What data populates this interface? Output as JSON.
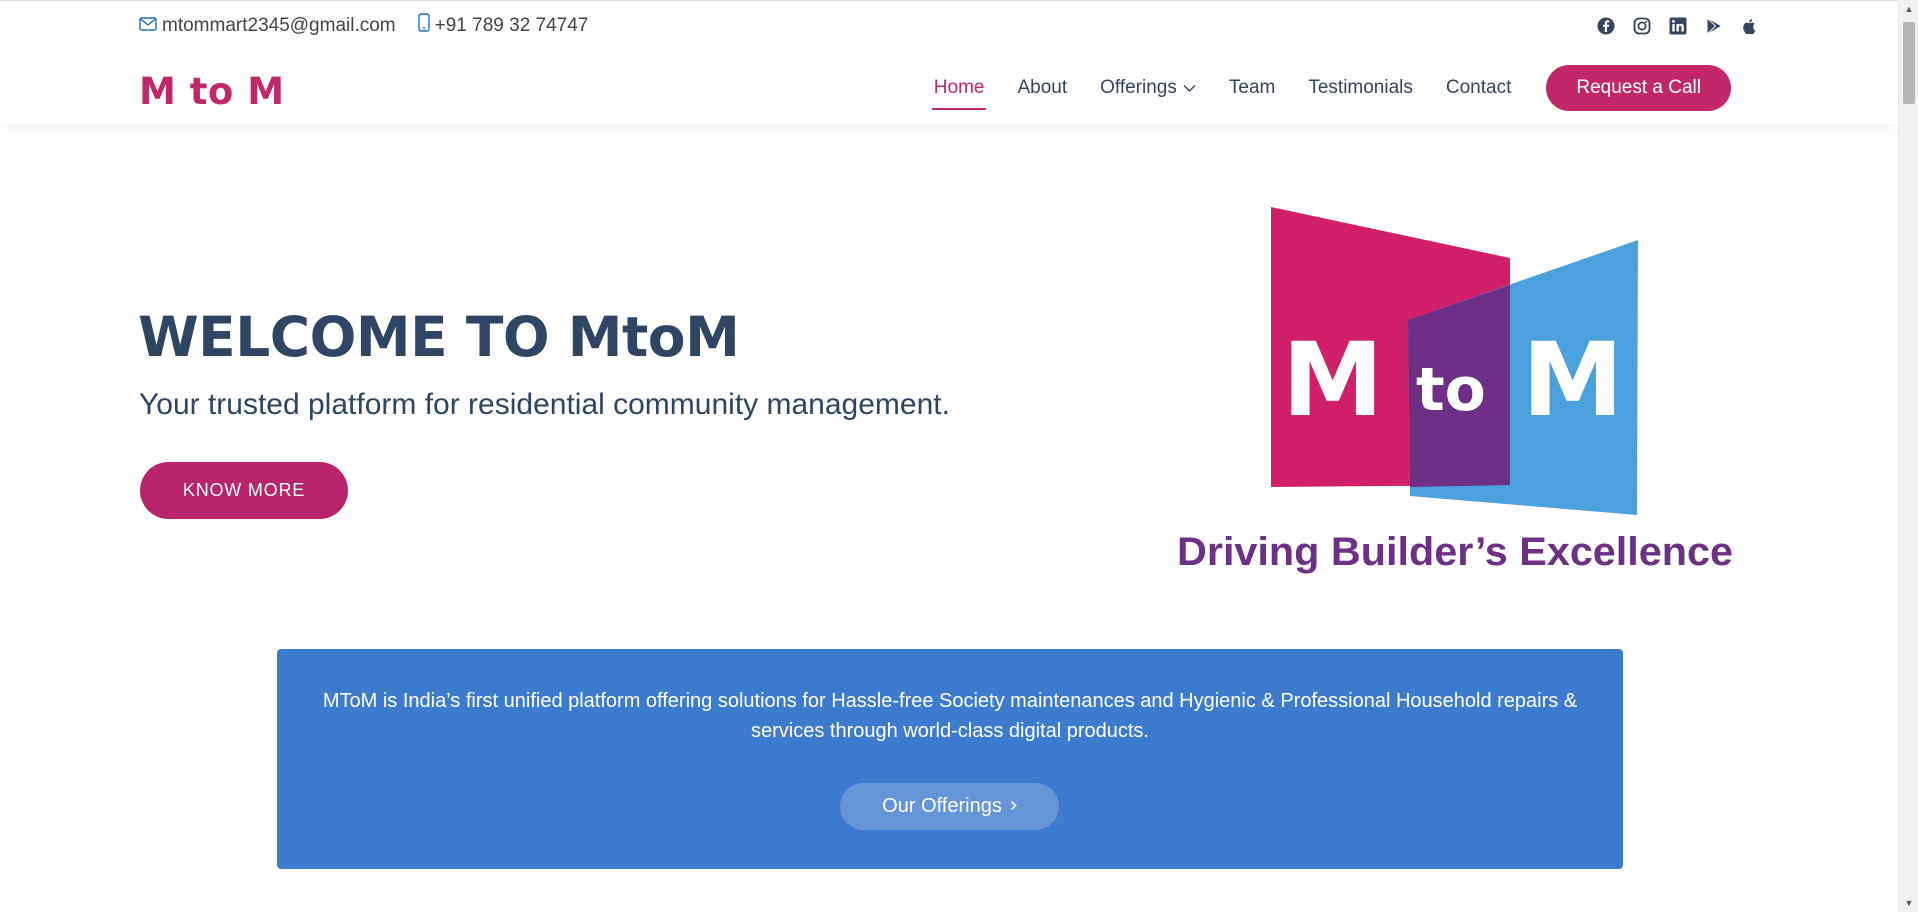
{
  "topbar": {
    "email": "mtommart2345@gmail.com",
    "phone": "+91 789 32 74747",
    "socials": [
      "facebook-icon",
      "instagram-icon",
      "linkedin-icon",
      "google-play-icon",
      "apple-icon"
    ],
    "icon_color": "#34455e"
  },
  "header": {
    "brand": "M to M",
    "brand_color": "#c1286a",
    "nav": {
      "home": "Home",
      "about": "About",
      "offerings": "Offerings",
      "team": "Team",
      "testimonials": "Testimonials",
      "contact": "Contact"
    },
    "cta": "Request a Call"
  },
  "hero": {
    "title": "WELCOME TO MtoM",
    "subtitle": "Your trusted platform for residential community management.",
    "button": "KNOW MORE"
  },
  "logo": {
    "left_letter": "M",
    "middle": "to",
    "right_letter": "M",
    "tagline": "Driving Builder’s Excellence",
    "colors": {
      "pink": "#d21f6a",
      "blue": "#4aa1dc",
      "overlap": "#6e2f86",
      "tagline": "#6e2f86"
    }
  },
  "info": {
    "text": "MToM is India’s first unified platform offering solutions for Hassle-free Society maintenances and Hygienic & Professional Household repairs & services through world-class digital products.",
    "button": "Our Offerings",
    "background": "#3d7bcf"
  },
  "colors": {
    "accent": "#c1286a",
    "text_dark": "#2e4563"
  }
}
